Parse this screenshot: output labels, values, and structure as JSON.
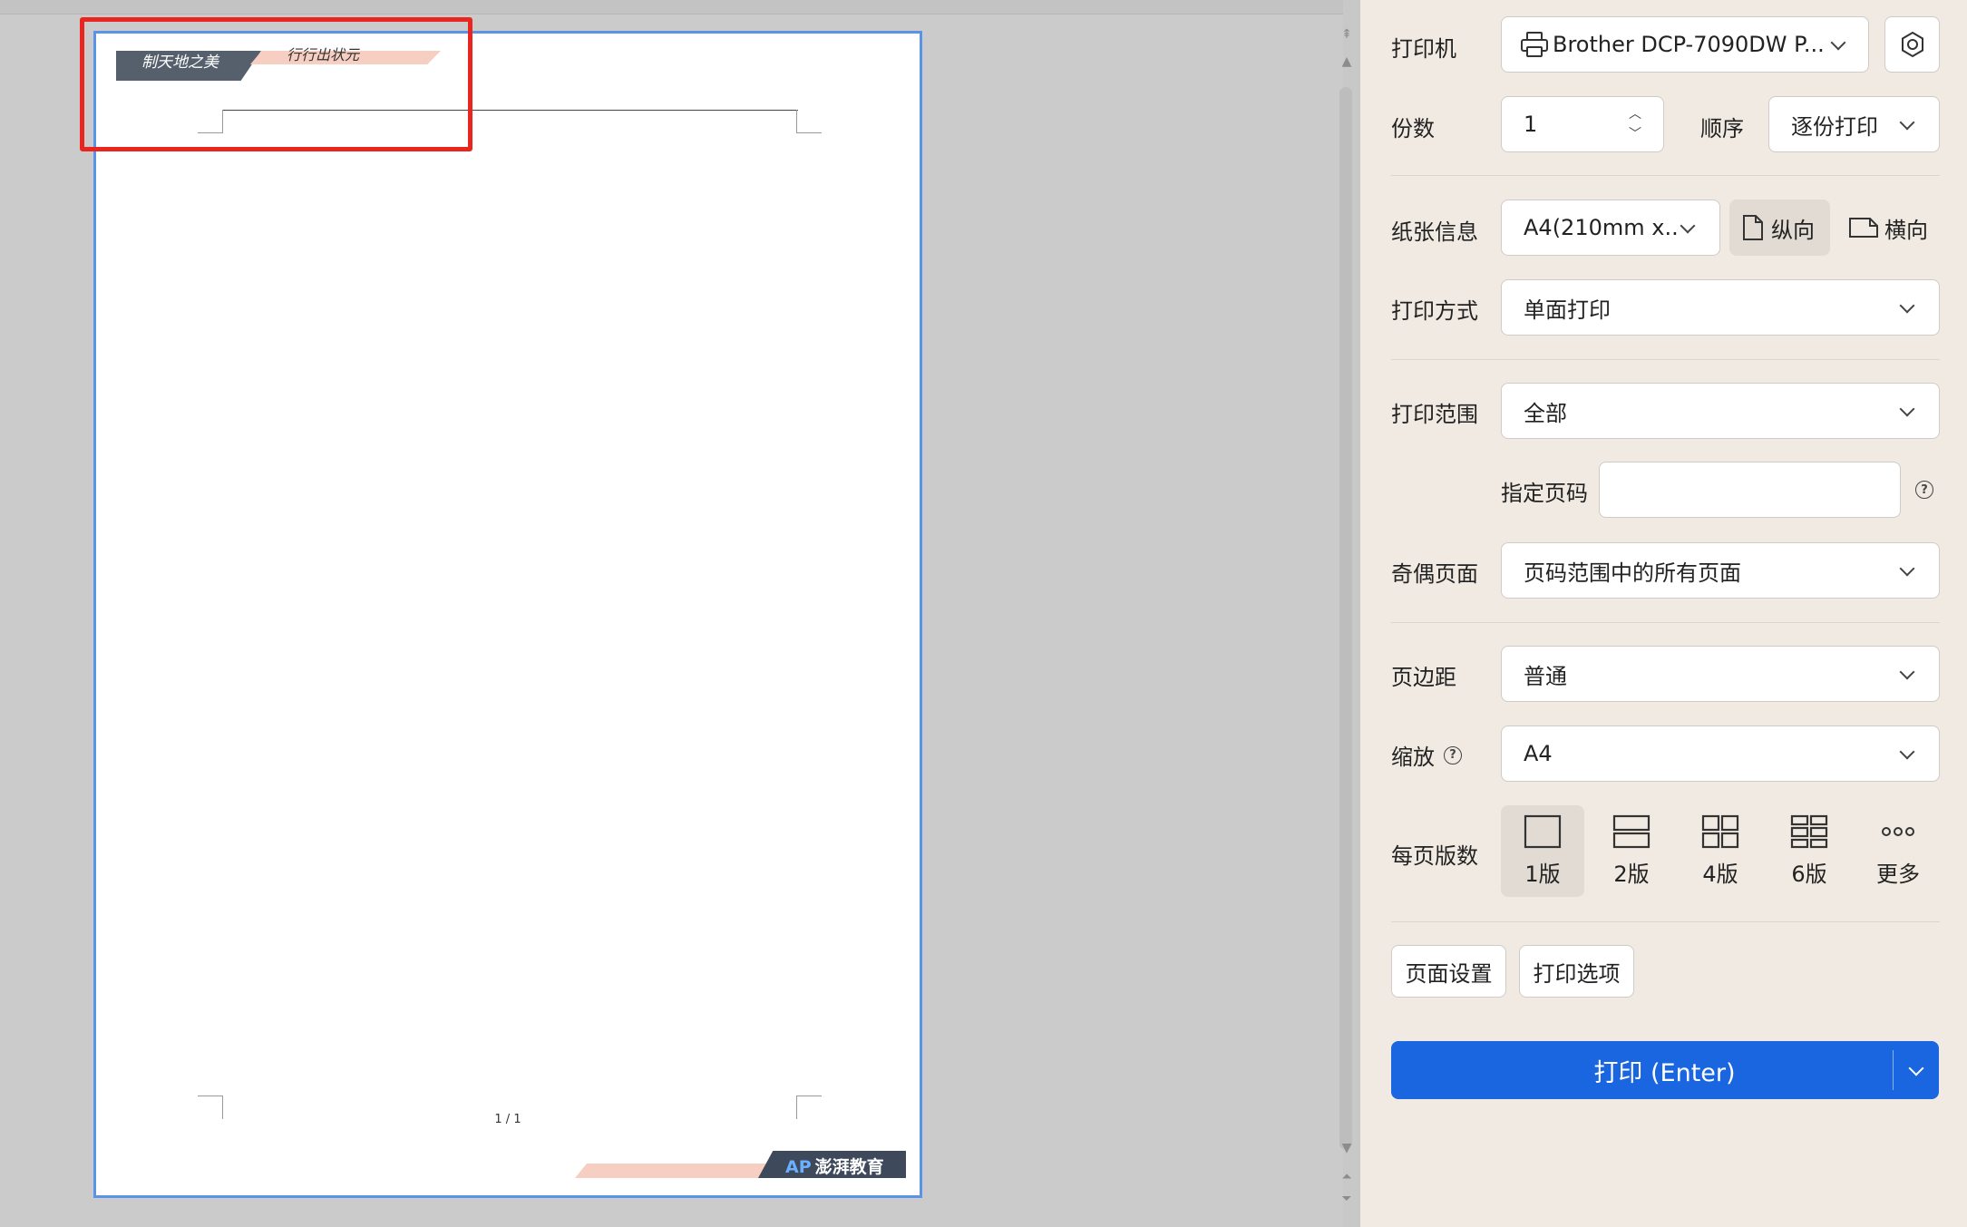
{
  "preview": {
    "header_text_left": "制天地之美",
    "header_text_right": "行行出状元",
    "page_number": "1 / 1",
    "footer_logo_mark": "AP",
    "footer_logo_text": "澎湃教育"
  },
  "panel": {
    "printer": {
      "label": "打印机",
      "value": "Brother DCP-7090DW P..."
    },
    "copies": {
      "label": "份数",
      "value": "1"
    },
    "order": {
      "label": "顺序",
      "value": "逐份打印"
    },
    "paper": {
      "label": "纸张信息",
      "value": "A4(210mm x...",
      "portrait": "纵向",
      "landscape": "横向"
    },
    "print_mode": {
      "label": "打印方式",
      "value": "单面打印"
    },
    "range": {
      "label": "打印范围",
      "value": "全部"
    },
    "pages": {
      "label": "指定页码",
      "value": ""
    },
    "odd_even": {
      "label": "奇偶页面",
      "value": "页码范围中的所有页面"
    },
    "margin": {
      "label": "页边距",
      "value": "普通"
    },
    "scale": {
      "label": "缩放",
      "value": "A4"
    },
    "per_page": {
      "label": "每页版数",
      "items": [
        {
          "label": "1版",
          "icon": "layout-1-icon"
        },
        {
          "label": "2版",
          "icon": "layout-2-icon"
        },
        {
          "label": "4版",
          "icon": "layout-4-icon"
        },
        {
          "label": "6版",
          "icon": "layout-6-icon"
        },
        {
          "label": "更多",
          "icon": "more-icon"
        }
      ]
    },
    "page_setup": "页面设置",
    "print_options": "打印选项",
    "print_button": "打印 (Enter)"
  },
  "colors": {
    "accent": "#1a66e0",
    "highlight": "#e8261f",
    "page_border": "#5b93e6",
    "panel_bg": "#f1eae2"
  }
}
